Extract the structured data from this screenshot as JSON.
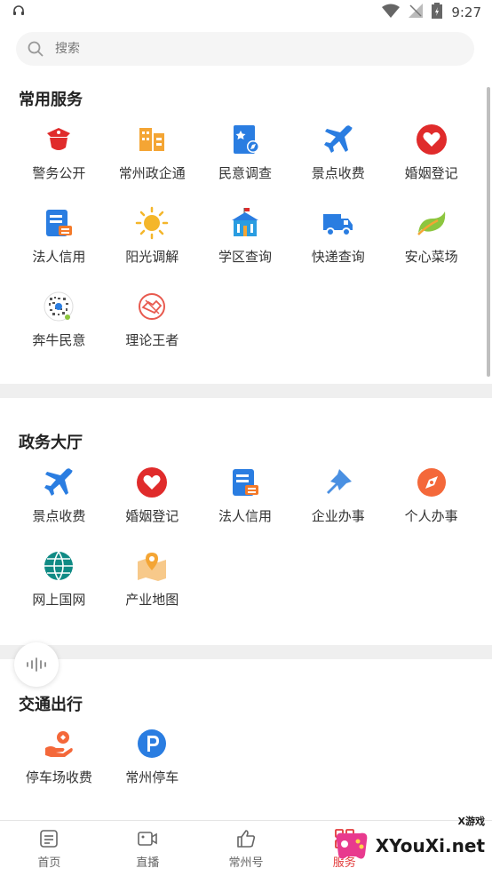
{
  "status_bar": {
    "time": "9:27"
  },
  "search": {
    "placeholder": "搜索"
  },
  "sections": [
    {
      "title": "常用服务",
      "items": [
        {
          "label": "警务公开",
          "icon": "police-icon"
        },
        {
          "label": "常州政企通",
          "icon": "building-icon"
        },
        {
          "label": "民意调查",
          "icon": "survey-icon"
        },
        {
          "label": "景点收费",
          "icon": "plane-icon"
        },
        {
          "label": "婚姻登记",
          "icon": "heart-icon"
        },
        {
          "label": "法人信用",
          "icon": "document-icon"
        },
        {
          "label": "阳光调解",
          "icon": "sun-icon"
        },
        {
          "label": "学区查询",
          "icon": "school-icon"
        },
        {
          "label": "快递查询",
          "icon": "truck-icon"
        },
        {
          "label": "安心菜场",
          "icon": "leaf-icon"
        },
        {
          "label": "奔牛民意",
          "icon": "qr-icon"
        },
        {
          "label": "理论王者",
          "icon": "handshake-icon"
        }
      ]
    },
    {
      "title": "政务大厅",
      "items": [
        {
          "label": "景点收费",
          "icon": "plane-icon"
        },
        {
          "label": "婚姻登记",
          "icon": "heart-icon"
        },
        {
          "label": "法人信用",
          "icon": "document-icon"
        },
        {
          "label": "企业办事",
          "icon": "pin-icon"
        },
        {
          "label": "个人办事",
          "icon": "compass-icon"
        },
        {
          "label": "网上国网",
          "icon": "globe-icon"
        },
        {
          "label": "产业地图",
          "icon": "map-icon"
        }
      ]
    },
    {
      "title": "交通出行",
      "items": [
        {
          "label": "停车场收费",
          "icon": "hand-coin-icon"
        },
        {
          "label": "常州停车",
          "icon": "parking-icon"
        }
      ]
    }
  ],
  "tabbar": [
    {
      "label": "首页",
      "icon": "news-icon"
    },
    {
      "label": "直播",
      "icon": "video-icon"
    },
    {
      "label": "常州号",
      "icon": "thumb-icon"
    },
    {
      "label": "服务",
      "icon": "grid-icon"
    },
    {
      "label": "",
      "icon": ""
    }
  ],
  "watermark": {
    "text": "XYouXi.net",
    "small": "X游戏"
  },
  "colors": {
    "red": "#e02b2b",
    "blue": "#2a7de1",
    "orange": "#f4a534",
    "active_tab": "#e23b3b"
  }
}
